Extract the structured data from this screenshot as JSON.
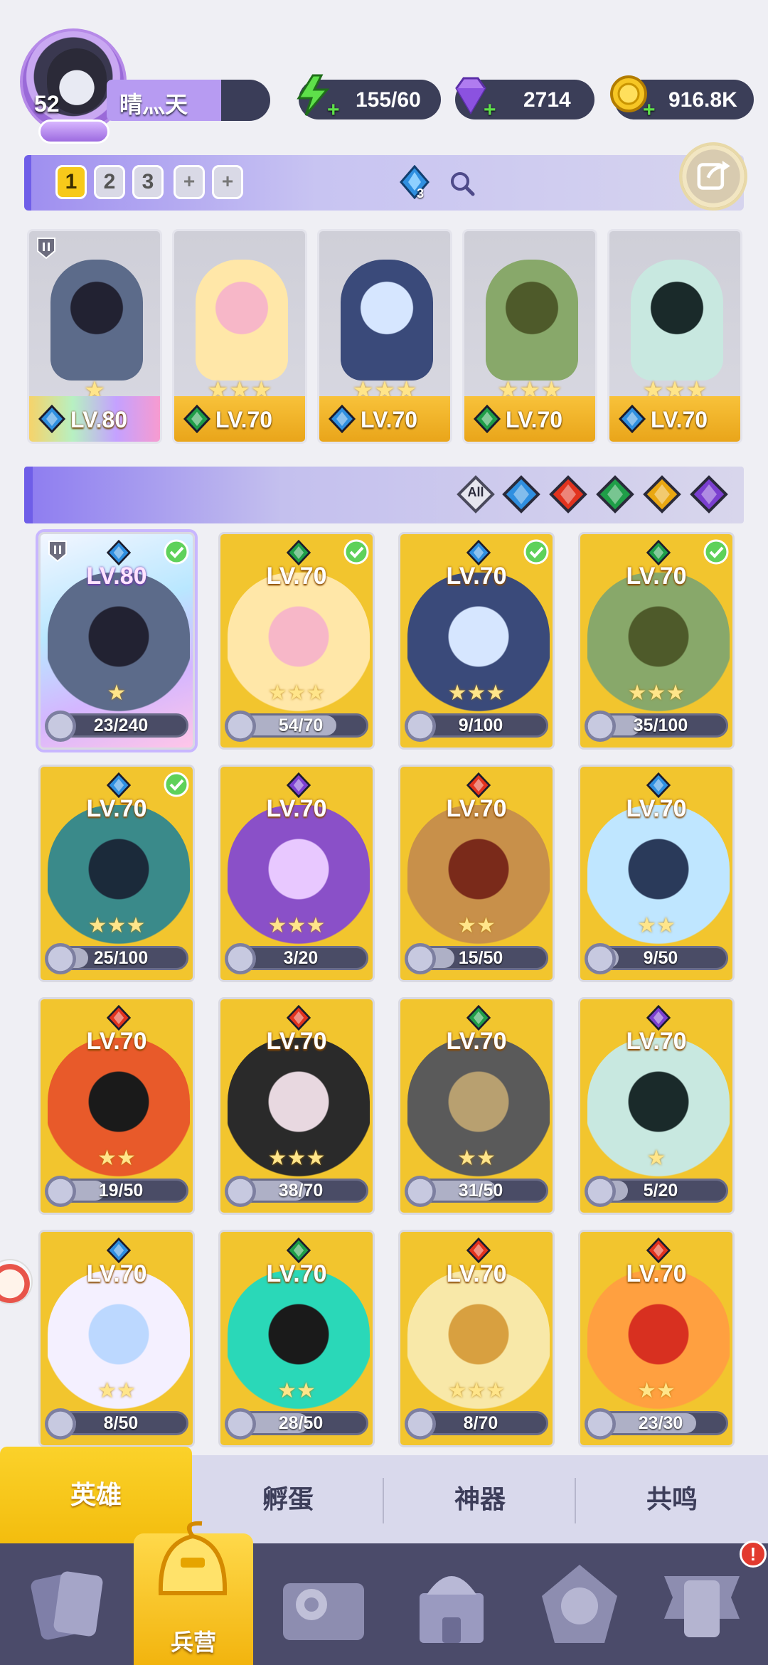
{
  "profile": {
    "level": "52",
    "name": "晴灬天"
  },
  "resources": [
    {
      "name": "energy",
      "icon": "lightning-icon",
      "value": "155/60"
    },
    {
      "name": "gems",
      "icon": "diamond-icon",
      "value": "2714"
    },
    {
      "name": "gold",
      "icon": "coin-icon",
      "value": "916.8K"
    }
  ],
  "team_tabs": [
    "1",
    "2",
    "3",
    "+",
    "+"
  ],
  "team_gem_count": "3",
  "team_slots": [
    {
      "level": "LV.80",
      "element": "water",
      "stars": "★",
      "rare": true
    },
    {
      "level": "LV.70",
      "element": "nature",
      "stars": "★★★",
      "rare": false
    },
    {
      "level": "LV.70",
      "element": "water",
      "stars": "★★★",
      "rare": false
    },
    {
      "level": "LV.70",
      "element": "nature",
      "stars": "★★★",
      "rare": false
    },
    {
      "level": "LV.70",
      "element": "water",
      "stars": "★★★",
      "rare": false
    }
  ],
  "filters": [
    "All",
    "water",
    "fire",
    "nature",
    "light",
    "dark"
  ],
  "filter_all_label": "All",
  "heroes": [
    {
      "level": "LV.80",
      "element": "water",
      "progress": "23/240",
      "ratio": 0.096,
      "checked": true,
      "rare": true,
      "stars": "★"
    },
    {
      "level": "LV.70",
      "element": "nature",
      "progress": "54/70",
      "ratio": 0.77,
      "checked": true,
      "rare": false,
      "stars": "★★★"
    },
    {
      "level": "LV.70",
      "element": "water",
      "progress": "9/100",
      "ratio": 0.09,
      "checked": true,
      "rare": false,
      "stars": "★★★"
    },
    {
      "level": "LV.70",
      "element": "nature",
      "progress": "35/100",
      "ratio": 0.35,
      "checked": true,
      "rare": false,
      "stars": "★★★"
    },
    {
      "level": "LV.70",
      "element": "water",
      "progress": "25/100",
      "ratio": 0.25,
      "checked": true,
      "rare": false,
      "stars": "★★★"
    },
    {
      "level": "LV.70",
      "element": "dark",
      "progress": "3/20",
      "ratio": 0.15,
      "checked": false,
      "rare": false,
      "stars": "★★★"
    },
    {
      "level": "LV.70",
      "element": "fire",
      "progress": "15/50",
      "ratio": 0.3,
      "checked": false,
      "rare": false,
      "stars": "★★"
    },
    {
      "level": "LV.70",
      "element": "water",
      "progress": "9/50",
      "ratio": 0.18,
      "checked": false,
      "rare": false,
      "stars": "★★"
    },
    {
      "level": "LV.70",
      "element": "fire",
      "progress": "19/50",
      "ratio": 0.38,
      "checked": false,
      "rare": false,
      "stars": "★★"
    },
    {
      "level": "LV.70",
      "element": "fire",
      "progress": "38/70",
      "ratio": 0.54,
      "checked": false,
      "rare": false,
      "stars": "★★★"
    },
    {
      "level": "LV.70",
      "element": "nature",
      "progress": "31/50",
      "ratio": 0.62,
      "checked": false,
      "rare": false,
      "stars": "★★"
    },
    {
      "level": "LV.70",
      "element": "dark",
      "progress": "5/20",
      "ratio": 0.25,
      "checked": false,
      "rare": false,
      "stars": "★"
    },
    {
      "level": "LV.70",
      "element": "water",
      "progress": "8/50",
      "ratio": 0.16,
      "checked": false,
      "rare": false,
      "stars": "★★"
    },
    {
      "level": "LV.70",
      "element": "nature",
      "progress": "28/50",
      "ratio": 0.56,
      "checked": false,
      "rare": false,
      "stars": "★★"
    },
    {
      "level": "LV.70",
      "element": "fire",
      "progress": "8/70",
      "ratio": 0.11,
      "checked": false,
      "rare": false,
      "stars": "★★★"
    },
    {
      "level": "LV.70",
      "element": "fire",
      "progress": "23/30",
      "ratio": 0.77,
      "checked": false,
      "rare": false,
      "stars": "★★"
    }
  ],
  "subtabs": [
    "英雄",
    "孵蛋",
    "神器",
    "共鸣"
  ],
  "nav": {
    "active_label": "兵营",
    "badge": "!"
  },
  "colors": {
    "water": "#2f8fe0",
    "fire": "#e2331e",
    "nature": "#1f9e48",
    "light": "#e9a712",
    "dark": "#7b3fd0",
    "accent": "#f7c91a"
  }
}
